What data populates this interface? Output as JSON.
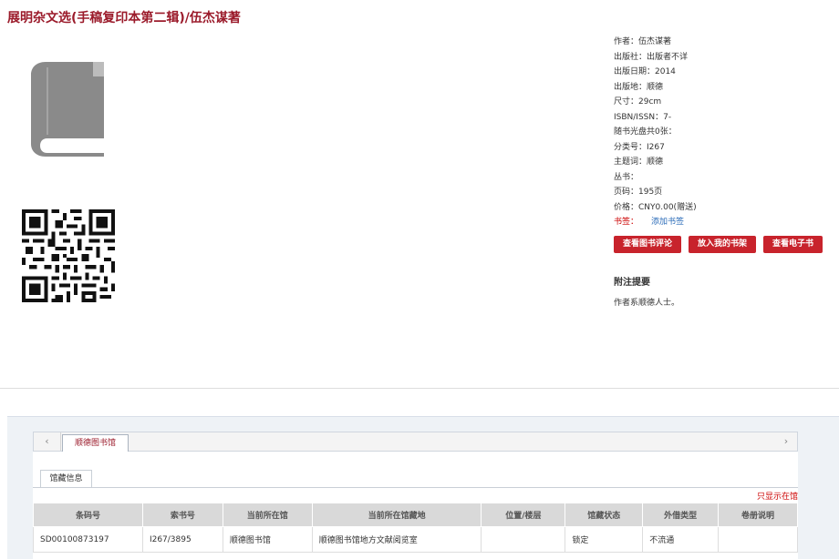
{
  "title": "展明杂文选(手稿复印本第二辑)/伍杰谋著",
  "meta": {
    "rows": [
      "作者：伍杰谋著",
      "出版社：出版者不详",
      "出版日期：2014",
      "出版地：顺德",
      "尺寸：29cm",
      "ISBN/ISSN：7-",
      "随书光盘共0张：",
      "分类号：I267",
      "主题词：顺德",
      "丛书：",
      "页码：195页",
      "价格：CNY0.00(赠送)"
    ],
    "tags_label": "书签：",
    "tags_link": "添加书签"
  },
  "buttons": {
    "review": "查看图书评论",
    "shelf": "放入我的书架",
    "ebook": "查看电子书"
  },
  "notes": {
    "heading": "附注提要",
    "body": "作者系顺德人士。"
  },
  "holdings": {
    "prev": "‹",
    "next": "›",
    "library_tab": "顺德图书馆",
    "subtab": "馆藏信息",
    "only_show": "只显示在馆",
    "headers": [
      "条码号",
      "索书号",
      "当前所在馆",
      "当前所在馆藏地",
      "位置/楼层",
      "馆藏状态",
      "外借类型",
      "卷册说明"
    ],
    "rows": [
      [
        "SD00100873197",
        "I267/3895",
        "顺德图书馆",
        "顺德图书馆地方文献阅览室",
        "",
        "锁定",
        "不流通",
        ""
      ]
    ]
  }
}
